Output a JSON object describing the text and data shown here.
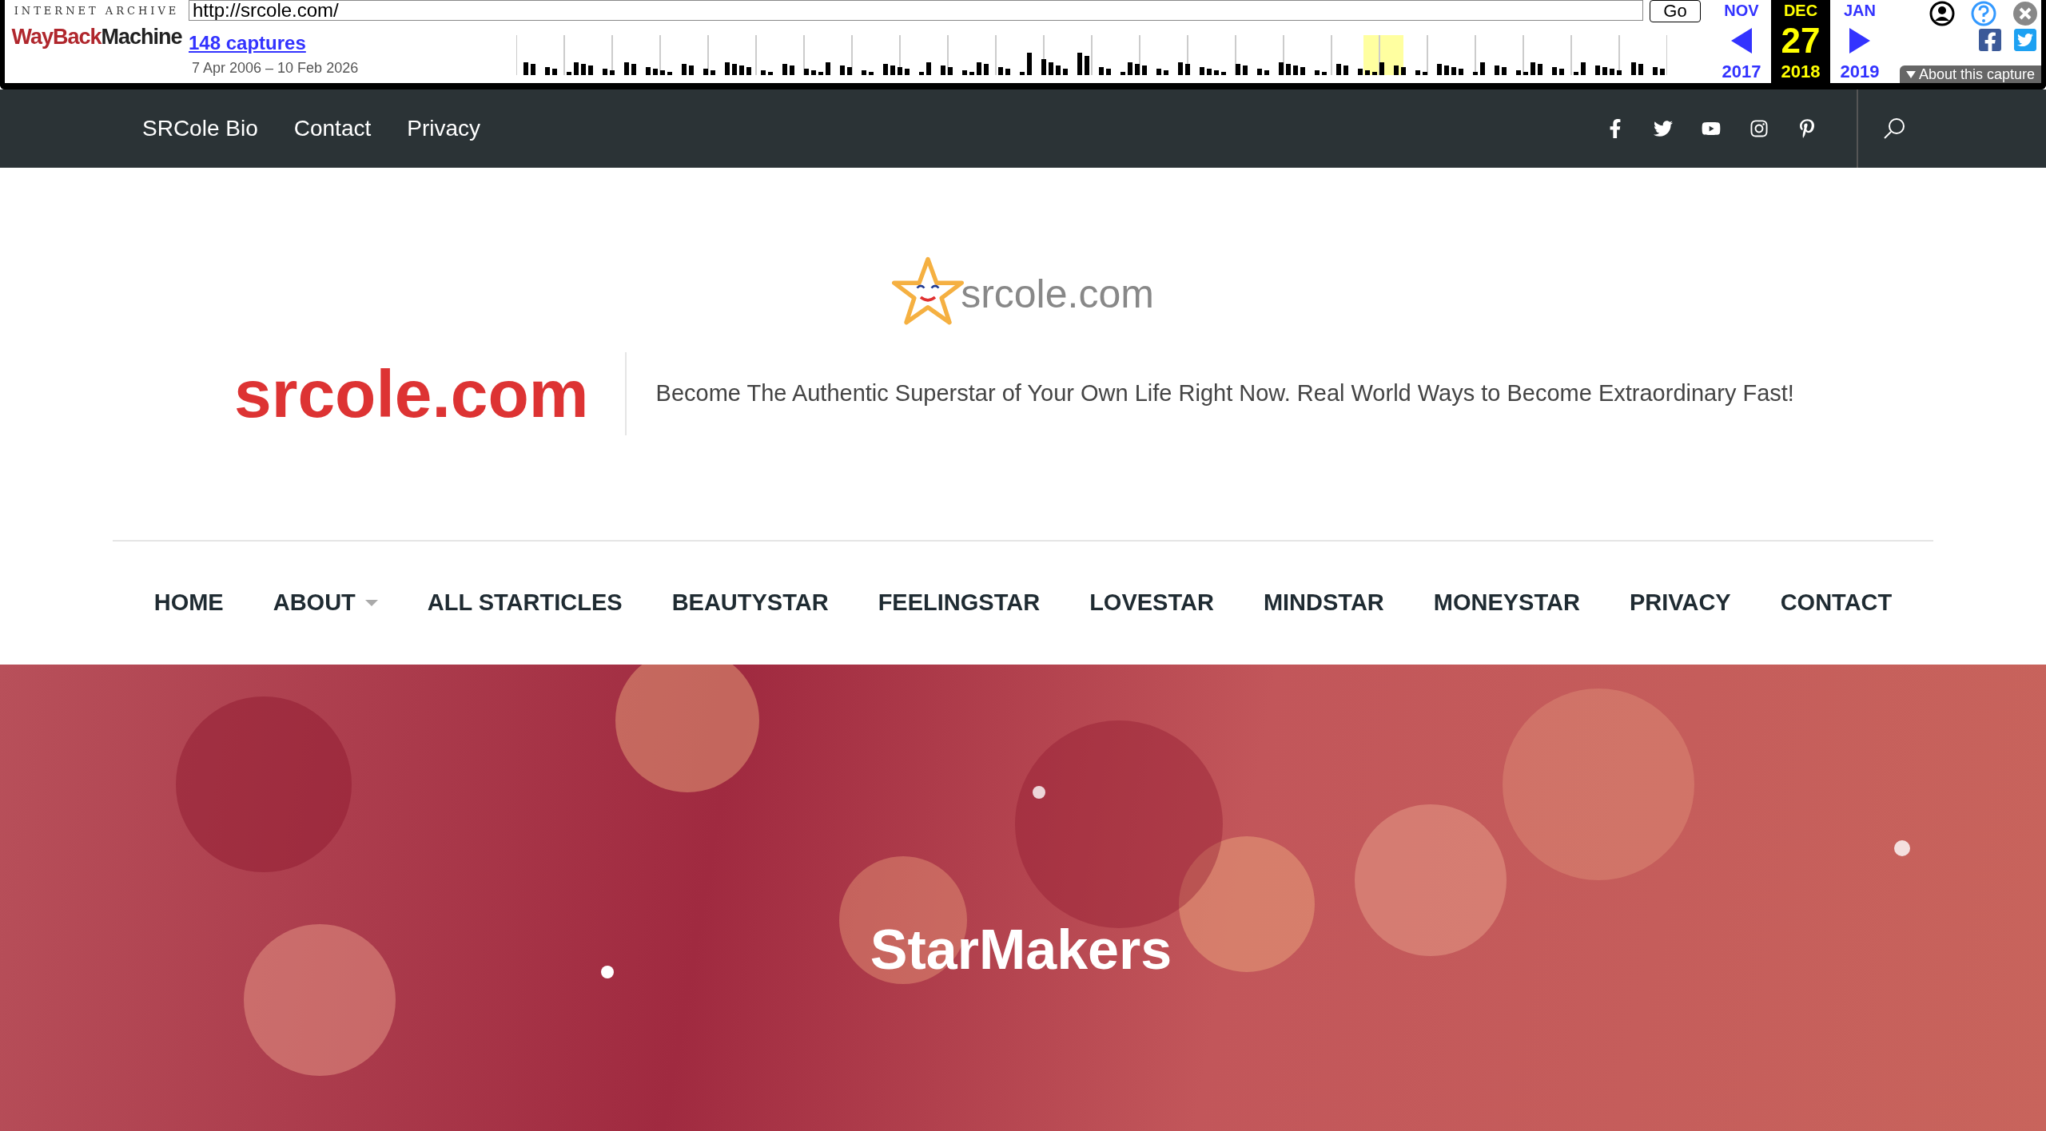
{
  "wayback": {
    "brand_top": "INTERNET ARCHIVE",
    "brand_red": "WayBack",
    "brand_dark": "Machine",
    "url": "http://srcole.com/",
    "go": "Go",
    "captures": "148 captures",
    "range": "7 Apr 2006 – 10 Feb 2026",
    "day": "27",
    "months": [
      {
        "kind": "prev",
        "month": "NOV",
        "year": "2017",
        "selected": false
      },
      {
        "kind": "current",
        "month": "DEC",
        "year": "2018",
        "selected": true
      },
      {
        "kind": "next",
        "month": "JAN",
        "year": "2019",
        "selected": false
      }
    ],
    "about": "About this capture"
  },
  "top_nav": {
    "links": [
      "SRCole Bio",
      "Contact",
      "Privacy"
    ]
  },
  "header": {
    "logo_text": "srcole.com",
    "site_title": "srcole.com",
    "tagline": "Become The Authentic Superstar of Your Own Life Right Now. Real World Ways to Become Extraordinary Fast!"
  },
  "main_menu": [
    {
      "label": "HOME",
      "has_dropdown": false
    },
    {
      "label": "ABOUT",
      "has_dropdown": true
    },
    {
      "label": "ALL STARTICLES",
      "has_dropdown": false
    },
    {
      "label": "BEAUTYSTAR",
      "has_dropdown": false
    },
    {
      "label": "FEELINGSTAR",
      "has_dropdown": false
    },
    {
      "label": "LOVESTAR",
      "has_dropdown": false
    },
    {
      "label": "MINDSTAR",
      "has_dropdown": false
    },
    {
      "label": "MONEYSTAR",
      "has_dropdown": false
    },
    {
      "label": "PRIVACY",
      "has_dropdown": false
    },
    {
      "label": "CONTACT",
      "has_dropdown": false
    }
  ],
  "hero": {
    "title": "StarMakers"
  }
}
